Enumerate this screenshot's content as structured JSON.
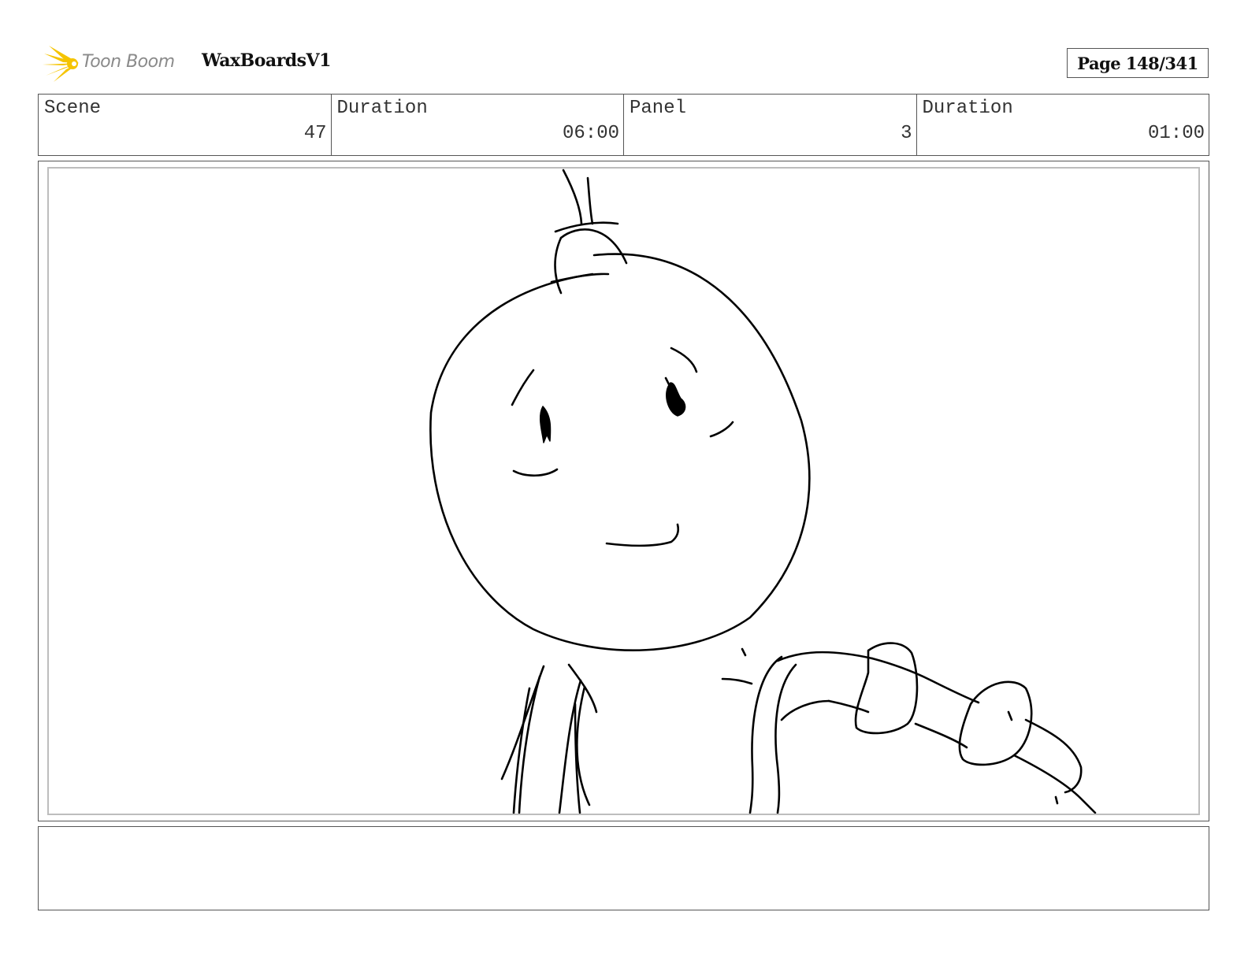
{
  "header": {
    "logo_text": "Toon Boom",
    "project_title": "WaxBoardsV1",
    "page_label": "Page 148/341"
  },
  "info": {
    "scene_label": "Scene",
    "scene_value": "47",
    "scene_duration_label": "Duration",
    "scene_duration_value": "06:00",
    "panel_label": "Panel",
    "panel_value": "3",
    "panel_duration_label": "Duration",
    "panel_duration_value": "01:00"
  },
  "colors": {
    "logo_accent": "#f5c400",
    "frame_border": "#555555",
    "inner_border": "#bdbdbd"
  },
  "notes": {
    "text": ""
  }
}
